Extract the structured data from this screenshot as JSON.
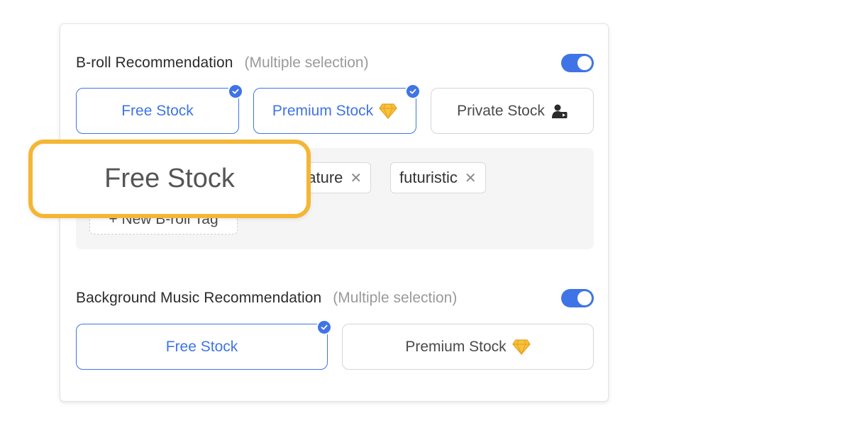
{
  "broll": {
    "title": "B-roll Recommendation",
    "hint": "(Multiple selection)",
    "toggle_on": true,
    "options": [
      {
        "label": "Free Stock",
        "selected": true
      },
      {
        "label": "Premium Stock",
        "selected": true,
        "icon": "diamond-icon"
      },
      {
        "label": "Private Stock",
        "selected": false,
        "icon": "person-video-icon"
      }
    ],
    "tags": [
      {
        "label": "nature"
      },
      {
        "label": "futuristic"
      }
    ],
    "new_tag_label": "+ New B-roll Tag"
  },
  "music": {
    "title": "Background Music Recommendation",
    "hint": "(Multiple selection)",
    "toggle_on": true,
    "options": [
      {
        "label": "Free Stock",
        "selected": true
      },
      {
        "label": "Premium Stock",
        "selected": false,
        "icon": "diamond-icon"
      }
    ]
  },
  "callout": {
    "label": "Free Stock"
  },
  "colors": {
    "accent": "#3f74e6",
    "callout_border": "#f5b635",
    "gem": "#f5b635"
  }
}
